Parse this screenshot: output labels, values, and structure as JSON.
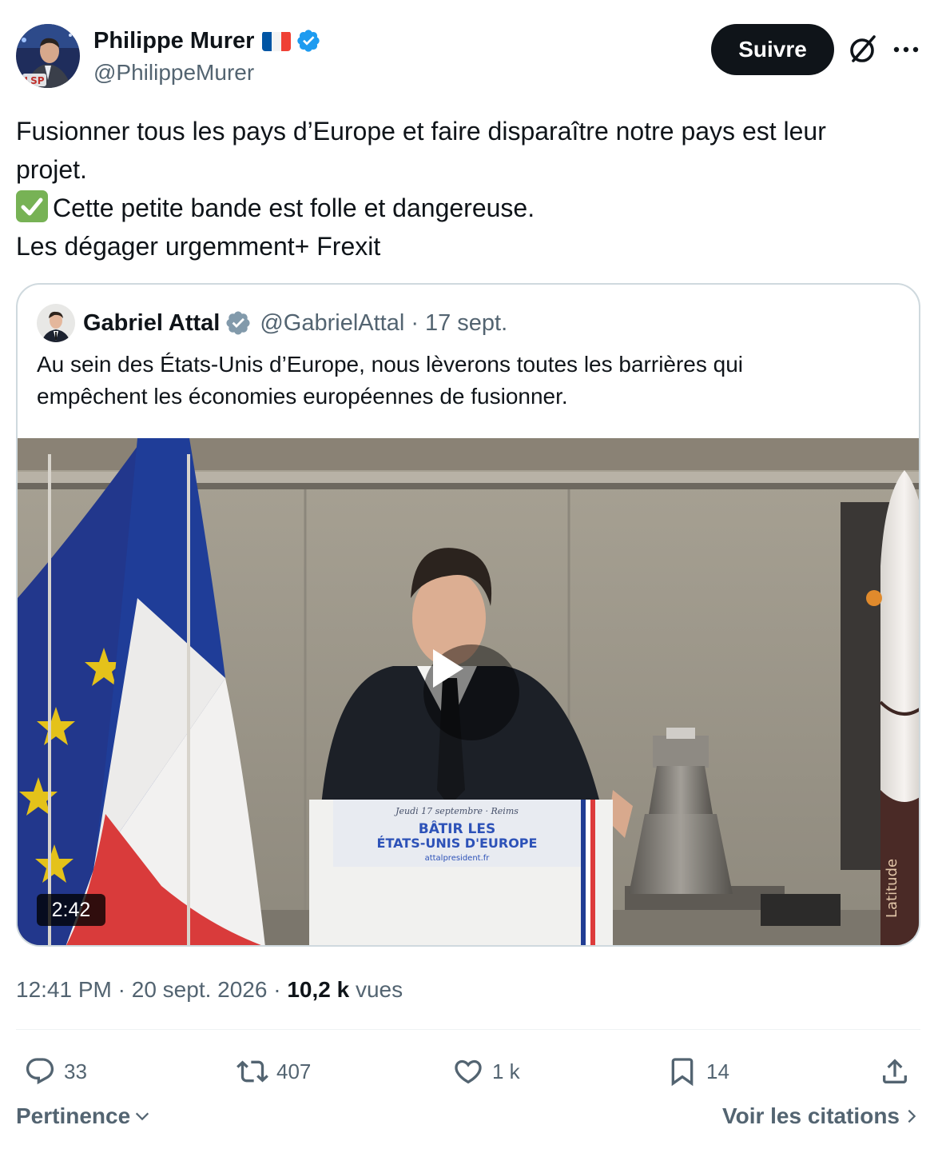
{
  "author": {
    "name": "Philippe Murer",
    "handle": "@PhilippeMurer",
    "flag_icon": "france-flag-icon",
    "verified_icon": "verified-badge-icon",
    "avatar_label": "LSP"
  },
  "header": {
    "follow_label": "Suivre",
    "grok_icon": "grok-icon",
    "more_icon": "more-horizontal-icon"
  },
  "tweet": {
    "lines": [
      "Fusionner tous les pays d’Europe et faire disparaître notre pays est leur",
      "projet.",
      "Cette petite bande est folle et dangereuse.",
      "Les dégager urgemment+ Frexit"
    ],
    "emoji": "✅"
  },
  "quote": {
    "name": "Gabriel Attal",
    "handle": "@GabrielAttal",
    "separator": "·",
    "date": "17 sept.",
    "lines": [
      "Au sein des États-Unis d’Europe, nous lèverons toutes les barrières qui",
      "empêchent les économies européennes de fusionner."
    ],
    "video": {
      "duration": "2:42",
      "podium_top": "Jeudi 17 septembre · Reims",
      "podium_title1": "BÂTIR LES",
      "podium_title2": "ÉTATS-UNIS D'EUROPE",
      "podium_url": "attalpresident.fr",
      "rocket_text": "Latitude"
    }
  },
  "meta": {
    "time": "12:41 PM",
    "separator": "·",
    "date": "20 sept. 2026",
    "views_count": "10,2 k",
    "views_label": "vues"
  },
  "actions": {
    "replies": "33",
    "reposts": "407",
    "likes": "1 k",
    "bookmarks": "14"
  },
  "footer": {
    "sort_label": "Pertinence",
    "quotes_link": "Voir les citations"
  },
  "colors": {
    "text": "#0f1419",
    "secondary": "#536471",
    "border": "#cfd9de",
    "verified": "#1d9bf0",
    "follow_bg": "#0f1419"
  }
}
